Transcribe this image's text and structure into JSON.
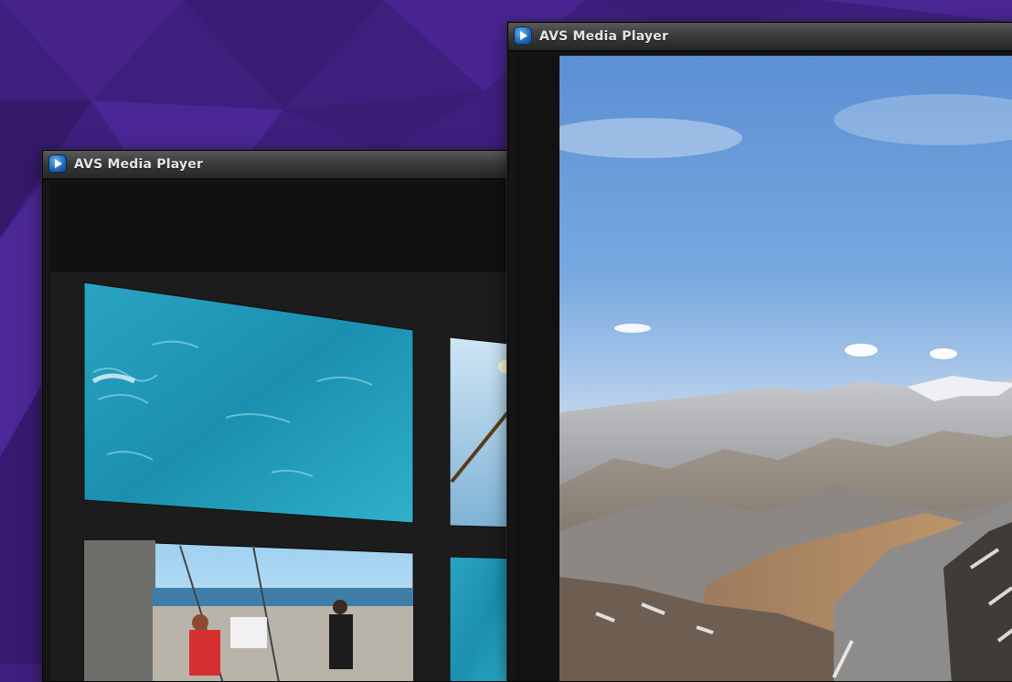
{
  "desktop": {
    "background_color": "#3f1f7e"
  },
  "windows": [
    {
      "title": "AVS Media Player",
      "icon": "play-icon",
      "state": "inactive"
    },
    {
      "title": "AVS Media Player",
      "icon": "play-icon",
      "state": "active"
    }
  ],
  "gallery": {
    "tiles": [
      {
        "subject": "ocean water"
      },
      {
        "subject": "ship mast and sky"
      },
      {
        "subject": "people on cruise ship deck"
      },
      {
        "subject": "ocean water"
      }
    ]
  },
  "video": {
    "subject": "mountain range under blue sky"
  }
}
